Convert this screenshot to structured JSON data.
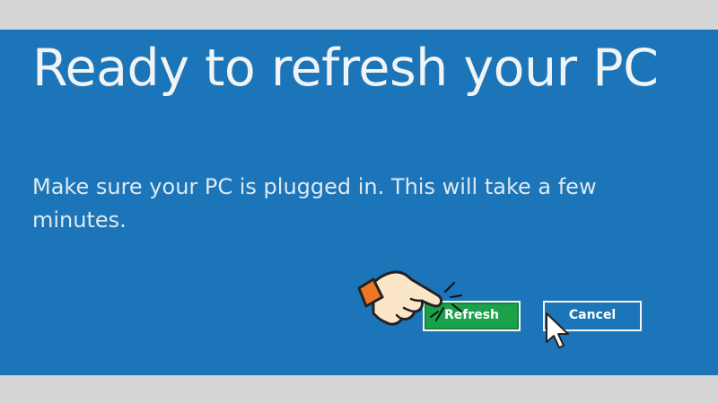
{
  "dialog": {
    "title": "Ready to refresh your PC",
    "message": "Make sure your PC is plugged in. This will take a few minutes.",
    "buttons": {
      "refresh_label": "Refresh",
      "cancel_label": "Cancel"
    }
  },
  "colors": {
    "background": "#1b75b8",
    "refresh_button": "#1aa24b",
    "text": "#f1f4f6"
  },
  "icons": {
    "hand": "pointing-hand-icon",
    "cursor": "mouse-pointer-icon"
  }
}
